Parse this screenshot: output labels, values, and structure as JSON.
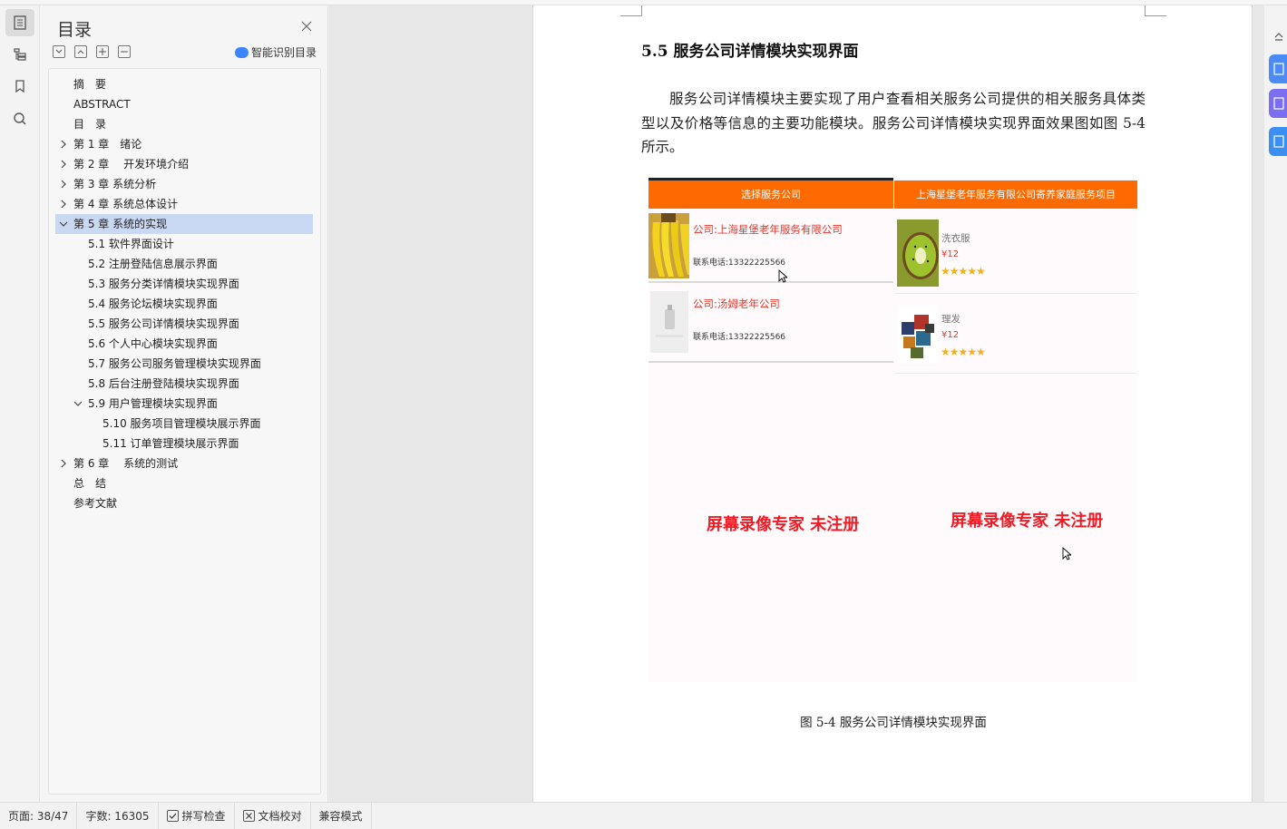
{
  "toc": {
    "title": "目录",
    "smart_label": "智能识别目录",
    "items": [
      {
        "label": "摘　要"
      },
      {
        "label": "ABSTRACT"
      },
      {
        "label": "目　录"
      },
      {
        "label": "第 1 章　绪论"
      },
      {
        "label": "第 2 章　 开发环境介绍"
      },
      {
        "label": "第 3 章  系统分析"
      },
      {
        "label": "第 4 章  系统总体设计"
      },
      {
        "label": "第 5 章  系统的实现"
      },
      {
        "label": "5.1  软件界面设计"
      },
      {
        "label": "5.2  注册登陆信息展示界面"
      },
      {
        "label": "5.3  服务分类详情模块实现界面"
      },
      {
        "label": "5.4  服务论坛模块实现界面"
      },
      {
        "label": "5.5 服务公司详情模块实现界面"
      },
      {
        "label": "5.6 个人中心模块实现界面"
      },
      {
        "label": "5.7 服务公司服务管理模块实现界面"
      },
      {
        "label": "5.8  后台注册登陆模块实现界面"
      },
      {
        "label": "5.9  用户管理模块实现界面"
      },
      {
        "label": "5.10  服务项目管理模块展示界面"
      },
      {
        "label": "5.11 订单管理模块展示界面"
      },
      {
        "label": "第 6 章　 系统的测试"
      },
      {
        "label": "总　结"
      },
      {
        "label": "参考文献"
      }
    ]
  },
  "document": {
    "heading": "5.5 服务公司详情模块实现界面",
    "paragraph": "服务公司详情模块主要实现了用户查看相关服务公司提供的相关服务具体类型以及价格等信息的主要功能模块。服务公司详情模块实现界面效果图如图 5-4 所示。",
    "caption": "图 5-4  服务公司详情模块实现界面",
    "figure": {
      "left_header": "选择服务公司",
      "right_header": "上海星堡老年服务有限公司寄养家庭服务项目",
      "companies": [
        {
          "name": "公司:上海星堡老年服务有限公司",
          "tel": "联系电话:13322225566"
        },
        {
          "name": "公司:汤姆老年公司",
          "tel": "联系电话:13322225566"
        }
      ],
      "services": [
        {
          "name": "洗衣服",
          "price": "¥12",
          "stars": "★★★★★"
        },
        {
          "name": "理发",
          "price": "¥12",
          "stars": "★★★★★"
        }
      ],
      "watermark": "屏幕录像专家  未注册",
      "colors": {
        "header": "#ff6a00",
        "company_name": "#e2382b",
        "watermark": "#ee1c25"
      }
    }
  },
  "status": {
    "page": "页面: 38/47",
    "words": "字数: 16305",
    "spell": "拼写检查",
    "proof": "文档校对",
    "compat": "兼容模式"
  }
}
